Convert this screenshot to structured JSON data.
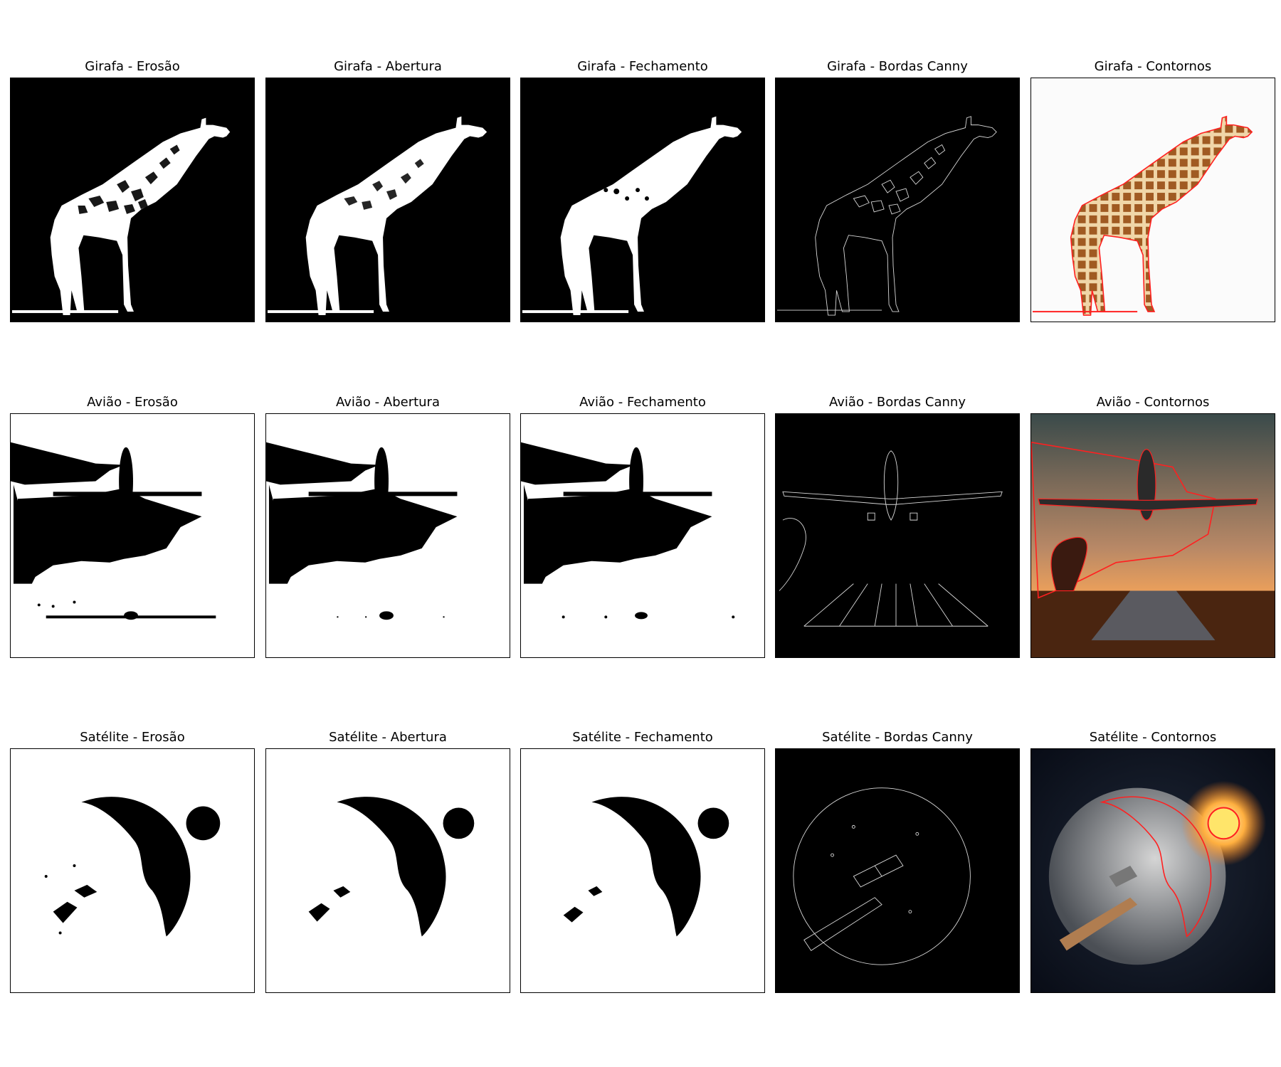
{
  "figure": {
    "rows": [
      {
        "subject": "Girafa",
        "panels": [
          {
            "title": "Girafa - Erosão",
            "render": "binary-white-on-black"
          },
          {
            "title": "Girafa - Abertura",
            "render": "binary-white-on-black"
          },
          {
            "title": "Girafa - Fechamento",
            "render": "binary-white-on-black"
          },
          {
            "title": "Girafa - Bordas Canny",
            "render": "edges"
          },
          {
            "title": "Girafa - Contornos",
            "render": "photo-with-red-contours"
          }
        ]
      },
      {
        "subject": "Avião",
        "panels": [
          {
            "title": "Avião - Erosão",
            "render": "binary-black-on-white"
          },
          {
            "title": "Avião - Abertura",
            "render": "binary-black-on-white"
          },
          {
            "title": "Avião - Fechamento",
            "render": "binary-black-on-white"
          },
          {
            "title": "Avião - Bordas Canny",
            "render": "edges"
          },
          {
            "title": "Avião - Contornos",
            "render": "photo-with-red-contours"
          }
        ]
      },
      {
        "subject": "Satélite",
        "panels": [
          {
            "title": "Satélite - Erosão",
            "render": "binary-black-on-white"
          },
          {
            "title": "Satélite - Abertura",
            "render": "binary-black-on-white"
          },
          {
            "title": "Satélite - Fechamento",
            "render": "binary-black-on-white"
          },
          {
            "title": "Satélite - Bordas Canny",
            "render": "edges"
          },
          {
            "title": "Satélite - Contornos",
            "render": "photo-with-red-contours"
          }
        ]
      }
    ],
    "colors": {
      "contour": "#ff2020",
      "edge": "#d8d8d8",
      "mask_fg_giraffe": "#ffffff",
      "mask_bg_giraffe": "#000000"
    }
  }
}
